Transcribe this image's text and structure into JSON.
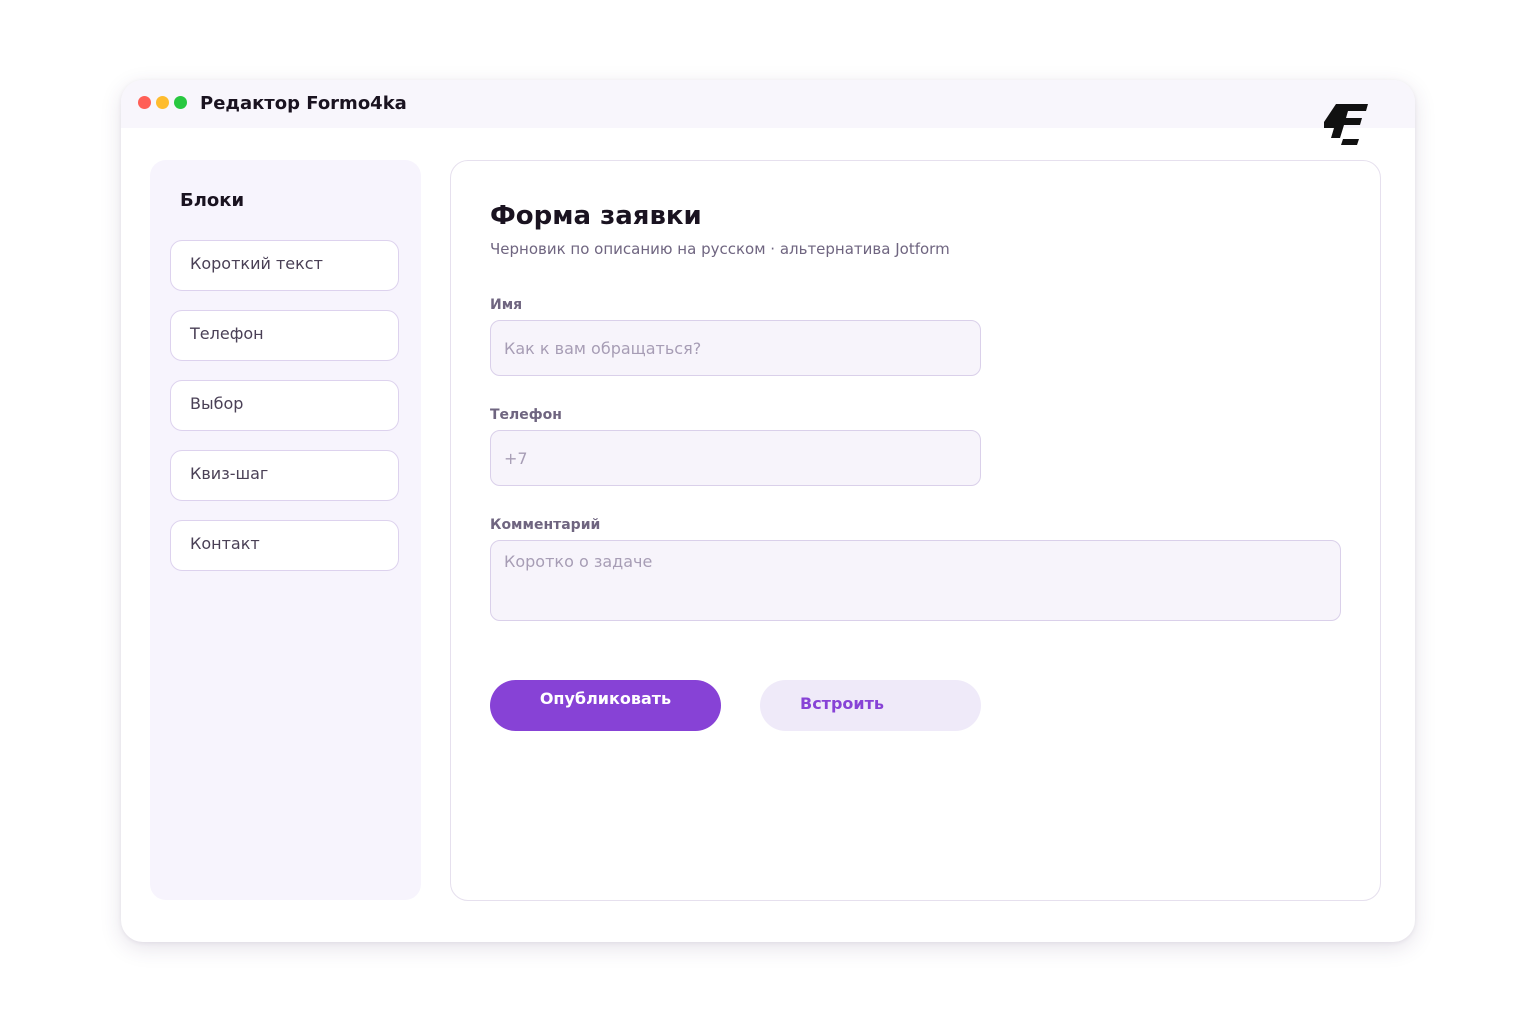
{
  "window": {
    "title": "Редактор Formo4ka"
  },
  "sidebar": {
    "title": "Блоки",
    "items": [
      {
        "label": "Короткий текст"
      },
      {
        "label": "Телефон"
      },
      {
        "label": "Выбор"
      },
      {
        "label": "Квиз-шаг"
      },
      {
        "label": "Контакт"
      }
    ]
  },
  "form": {
    "title": "Форма заявки",
    "subtitle": "Черновик по описанию на русском · альтернатива Jotform",
    "fields": [
      {
        "label": "Имя",
        "placeholder": "Как к вам обращаться?",
        "value": ""
      },
      {
        "label": "Телефон",
        "placeholder": "+7",
        "value": ""
      },
      {
        "label": "Комментарий",
        "placeholder": "Коротко о задаче",
        "value": ""
      }
    ]
  },
  "actions": {
    "publish_label": "Опубликовать",
    "embed_label": "Встроить"
  },
  "colors": {
    "accent": "#8742d6",
    "accent_soft": "#efeaf9",
    "panel_bg": "#f7f4fd",
    "dot_red": "#ff5f57",
    "dot_yellow": "#febc2e",
    "dot_green": "#28c840"
  },
  "icons": {
    "logo": "formo4ka-logo-icon"
  }
}
